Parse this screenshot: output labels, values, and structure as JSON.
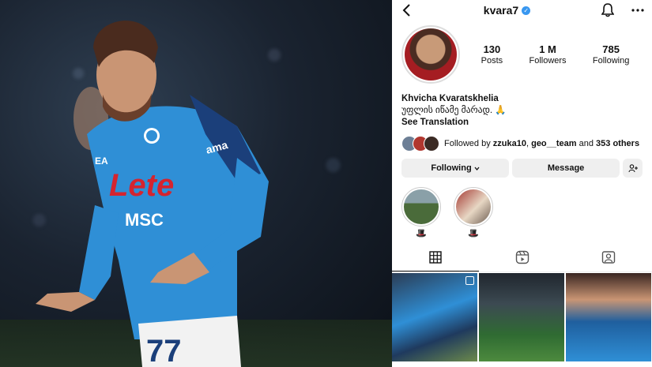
{
  "profile": {
    "username": "kvara7",
    "stats": [
      {
        "num": "130",
        "label": "Posts"
      },
      {
        "num": "1 M",
        "label": "Followers"
      },
      {
        "num": "785",
        "label": "Following"
      }
    ],
    "name": "Khvicha Kvaratskhelia",
    "bio": "უფლის იწამე მარად. 🙏",
    "see_translation": "See Translation",
    "followed_prefix": "Followed by ",
    "followed_user1": "zzuka10",
    "followed_sep": ", ",
    "followed_user2": "geo__team",
    "followed_and": " and ",
    "followed_others": "353 others"
  },
  "actions": {
    "following_label": "Following",
    "message_label": "Message"
  },
  "highlights": [
    {
      "emoji": "🎩"
    },
    {
      "emoji": "🎩"
    }
  ],
  "icons": {
    "back": "back-chevron-icon",
    "notifications": "bell-icon",
    "more": "more-dots-icon",
    "add_friend": "add-user-icon",
    "grid_tab": "grid-icon",
    "reels_tab": "reels-icon",
    "tagged_tab": "tagged-icon"
  },
  "colors": {
    "verified": "#3897f0",
    "napoli_blue": "#2f8fd6",
    "button_bg": "#efefef"
  }
}
